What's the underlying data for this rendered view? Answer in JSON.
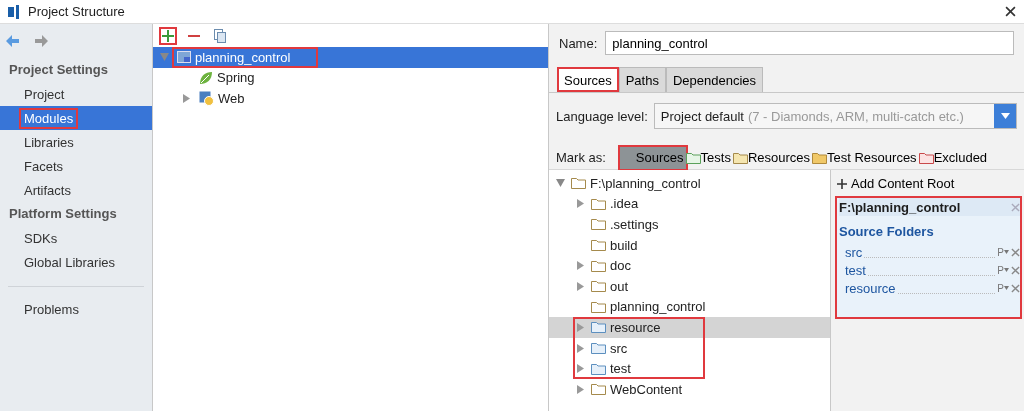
{
  "window": {
    "title": "Project Structure"
  },
  "sidebar": {
    "sections": [
      {
        "title": "Project Settings",
        "items": [
          {
            "label": "Project",
            "selected": false,
            "highlighted": false
          },
          {
            "label": "Modules",
            "selected": true,
            "highlighted": true
          },
          {
            "label": "Libraries",
            "selected": false,
            "highlighted": false
          },
          {
            "label": "Facets",
            "selected": false,
            "highlighted": false
          },
          {
            "label": "Artifacts",
            "selected": false,
            "highlighted": false
          }
        ]
      },
      {
        "title": "Platform Settings",
        "items": [
          {
            "label": "SDKs",
            "selected": false,
            "highlighted": false
          },
          {
            "label": "Global Libraries",
            "selected": false,
            "highlighted": false
          }
        ]
      },
      {
        "items": [
          {
            "label": "Problems",
            "selected": false,
            "highlighted": false
          }
        ]
      }
    ]
  },
  "modules": {
    "toolbar": [
      {
        "kind": "add",
        "highlighted": true
      },
      {
        "kind": "remove",
        "highlighted": false
      },
      {
        "kind": "copy",
        "highlighted": false
      }
    ],
    "tree": [
      {
        "label": "planning_control",
        "kind": "module",
        "expandable": true,
        "expanded": true,
        "selected": true,
        "highlighted": true,
        "children": [
          {
            "label": "Spring",
            "kind": "spring",
            "expandable": false,
            "selected": false,
            "highlighted": false
          },
          {
            "label": "Web",
            "kind": "web",
            "expandable": true,
            "expanded": false,
            "selected": false,
            "highlighted": false
          }
        ]
      }
    ]
  },
  "details": {
    "name_label": "Name:",
    "name_value": "planning_control",
    "tabs": [
      {
        "label": "Sources",
        "selected": true,
        "highlighted": true
      },
      {
        "label": "Paths",
        "selected": false,
        "highlighted": false
      },
      {
        "label": "Dependencies",
        "selected": false,
        "highlighted": false
      }
    ],
    "language_label": "Language level:",
    "language_value": "Project default",
    "language_hint": "(7 - Diamonds, ARM, multi-catch etc.)",
    "mark_label": "Mark as:",
    "mark_options": [
      {
        "label": "Sources",
        "kind": "sources",
        "selected": true,
        "highlighted": true
      },
      {
        "label": "Tests",
        "kind": "tests",
        "selected": false,
        "highlighted": false
      },
      {
        "label": "Resources",
        "kind": "resources",
        "selected": false,
        "highlighted": false
      },
      {
        "label": "Test Resources",
        "kind": "test_resources",
        "selected": false,
        "highlighted": false
      },
      {
        "label": "Excluded",
        "kind": "excluded",
        "selected": false,
        "highlighted": false
      }
    ],
    "folder_tree": [
      {
        "label": "F:\\planning_control",
        "kind": "folder",
        "expandable": true,
        "expanded": true,
        "selected": false,
        "highlighted": false,
        "children": [
          {
            "label": ".idea",
            "kind": "folder",
            "expandable": true,
            "expanded": false,
            "selected": false,
            "highlighted": false
          },
          {
            "label": ".settings",
            "kind": "folder",
            "expandable": false,
            "selected": false,
            "highlighted": false
          },
          {
            "label": "build",
            "kind": "folder",
            "expandable": false,
            "selected": false,
            "highlighted": false
          },
          {
            "label": "doc",
            "kind": "folder",
            "expandable": true,
            "expanded": false,
            "selected": false,
            "highlighted": false
          },
          {
            "label": "out",
            "kind": "folder",
            "expandable": true,
            "expanded": false,
            "selected": false,
            "highlighted": false
          },
          {
            "label": "planning_control",
            "kind": "folder",
            "expandable": false,
            "selected": false,
            "highlighted": false
          },
          {
            "label": "resource",
            "kind": "source",
            "expandable": true,
            "expanded": false,
            "selected": true,
            "highlighted": true
          },
          {
            "label": "src",
            "kind": "source",
            "expandable": true,
            "expanded": false,
            "selected": false,
            "highlighted": true
          },
          {
            "label": "test",
            "kind": "source",
            "expandable": true,
            "expanded": false,
            "selected": false,
            "highlighted": true
          },
          {
            "label": "WebContent",
            "kind": "folder",
            "expandable": true,
            "expanded": false,
            "selected": false,
            "highlighted": false
          }
        ]
      }
    ],
    "add_root": "Add Content Root",
    "content_root": {
      "path": "F:\\planning_control",
      "section": "Source Folders",
      "highlighted": true,
      "folders": [
        {
          "name": "src",
          "prefix_button": "P"
        },
        {
          "name": "test",
          "prefix_button": "P"
        },
        {
          "name": "resource",
          "prefix_button": "P"
        }
      ]
    }
  }
}
